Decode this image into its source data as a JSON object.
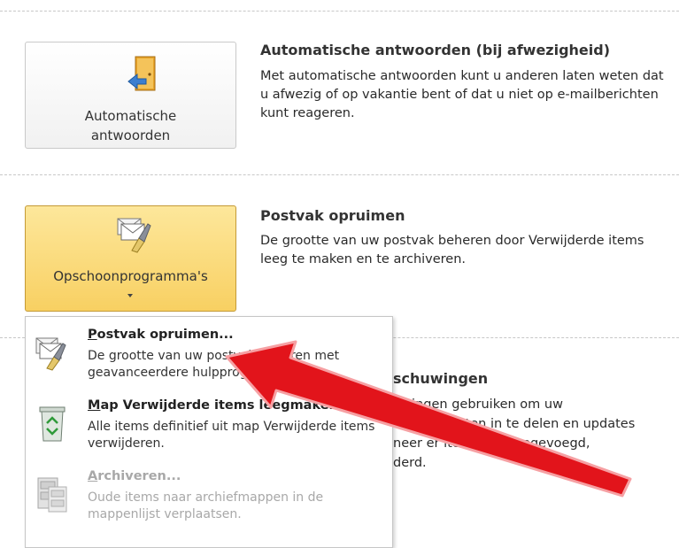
{
  "auto_reply": {
    "button_label_line1": "Automatische",
    "button_label_line2": "antwoorden",
    "title": "Automatische antwoorden (bij afwezigheid)",
    "description": "Met automatische antwoorden kunt u anderen laten weten dat u afwezig of op vakantie bent of dat u niet op e-mailberichten kunt reageren."
  },
  "cleanup": {
    "button_label": "Opschoonprogramma's",
    "title": "Postvak opruimen",
    "description": "De grootte van uw postvak beheren door Verwijderde items leeg te maken en te archiveren."
  },
  "rules": {
    "title_partial": "schuwingen",
    "desc_lines": [
      "uwingen gebruiken om uw",
      "-mailberichten in te delen en updates",
      "neer er items zijn toegevoegd,",
      "derd."
    ]
  },
  "dropdown": {
    "items": [
      {
        "title_u": "P",
        "title_rest": "ostvak opruimen...",
        "description": "De grootte van uw postvak beheren met geavanceerdere hulpprogramma's.",
        "enabled": true
      },
      {
        "title_u": "M",
        "title_rest": "ap Verwijderde items leegmaken",
        "description": "Alle items definitief uit map Verwijderde items verwijderen.",
        "enabled": true
      },
      {
        "title_u": "A",
        "title_rest": "rchiveren...",
        "description": "Oude items naar archiefmappen in de mappenlijst verplaatsen.",
        "enabled": false
      }
    ]
  },
  "colors": {
    "active_button": "#f8d062",
    "annotation_arrow": "#e2141b",
    "disabled_text": "#a8a8a8"
  }
}
